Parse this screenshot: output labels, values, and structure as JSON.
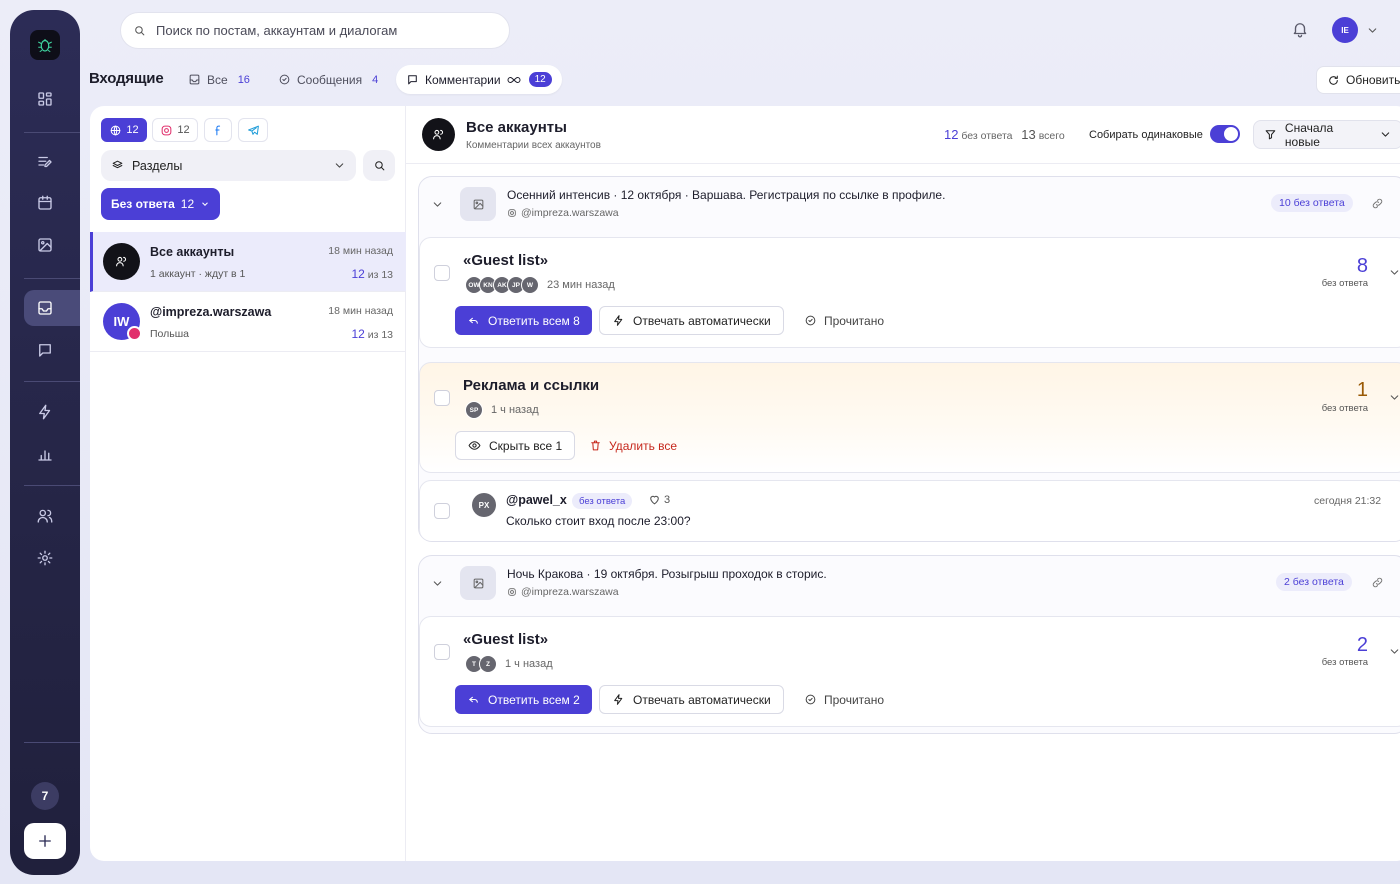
{
  "colors": {
    "accent": "#4b3fd6",
    "sidebar": "#2a2a52",
    "danger": "#c6281d",
    "amber": "#9a5a06"
  },
  "sidebar": {
    "badge_count": "7",
    "icons": [
      "dashboard-icon",
      "compose-icon",
      "calendar-icon",
      "image-icon",
      "inbox-icon",
      "chat-icon",
      "bolt-icon",
      "chart-icon",
      "users-icon",
      "settings-icon",
      "plus-icon"
    ]
  },
  "topbar": {
    "search_placeholder": "Поиск по постам, аккаунтам и диалогам",
    "avatar_initials": "IE"
  },
  "tabs": {
    "title": "Входящие",
    "items": [
      {
        "label": "Все",
        "count": "16"
      },
      {
        "label": "Сообщения",
        "count": "4"
      },
      {
        "label": "Комментарии",
        "count": "12"
      }
    ],
    "refresh_label": "Обновить"
  },
  "filters": {
    "chips": [
      {
        "platform": "all",
        "count": "12"
      },
      {
        "platform": "instagram",
        "count": "12"
      },
      {
        "platform": "facebook",
        "count": ""
      },
      {
        "platform": "telegram",
        "count": ""
      }
    ],
    "sections_label": "Разделы",
    "noans_label": "Без ответа",
    "noans_count": "12"
  },
  "accounts": [
    {
      "name": "Все аккаунты",
      "sub": "1 аккаунт · ждут в 1",
      "time": "18 мин назад",
      "count": "12",
      "total": "из 13"
    },
    {
      "name": "@impreza.warszawa",
      "initials": "IW",
      "sub": "Польша",
      "time": "18 мин назад",
      "count": "12",
      "total": "из 13"
    }
  ],
  "header": {
    "title": "Все аккаунты",
    "subtitle": "Комментарии всех аккаунтов",
    "noans_count": "12",
    "noans_label": "без ответа",
    "total_count": "13",
    "total_label": "всего",
    "collect_label": "Собирать одинаковые",
    "sort_label": "Сначала новые"
  },
  "posts": [
    {
      "title": "Осенний интенсив · 12 октября · Варшава. Регистрация по ссылке в профиле.",
      "handle": "@impreza.warszawa",
      "noans": "10 без ответа",
      "card1": {
        "title": "«Guest list»",
        "avatars": [
          "OW",
          "KN",
          "AK",
          "JP",
          "W"
        ],
        "time": "23 мин назад",
        "count": "8",
        "count_label": "без ответа",
        "reply_label": "Ответить всем 8",
        "auto_label": "Отвечать автоматически",
        "read_label": "Прочитано"
      },
      "card2": {
        "title": "Реклама и ссылки",
        "avatars": [
          "SP"
        ],
        "time": "1 ч назад",
        "count": "1",
        "count_label": "без ответа",
        "hide_label": "Скрыть все 1",
        "delete_label": "Удалить все"
      },
      "comment": {
        "initials": "PX",
        "user": "@pawel_x",
        "tag": "без ответа",
        "likes": "3",
        "text": "Сколько стоит вход после 23:00?",
        "time": "сегодня 21:32"
      }
    },
    {
      "title": "Ночь Кракова · 19 октября. Розыгрыш проходок в сторис.",
      "handle": "@impreza.warszawa",
      "noans": "2 без ответа",
      "card1": {
        "title": "«Guest list»",
        "avatars": [
          "T",
          "Z"
        ],
        "time": "1 ч назад",
        "count": "2",
        "count_label": "без ответа",
        "reply_label": "Ответить всем 2",
        "auto_label": "Отвечать автоматически",
        "read_label": "Прочитано"
      }
    }
  ]
}
